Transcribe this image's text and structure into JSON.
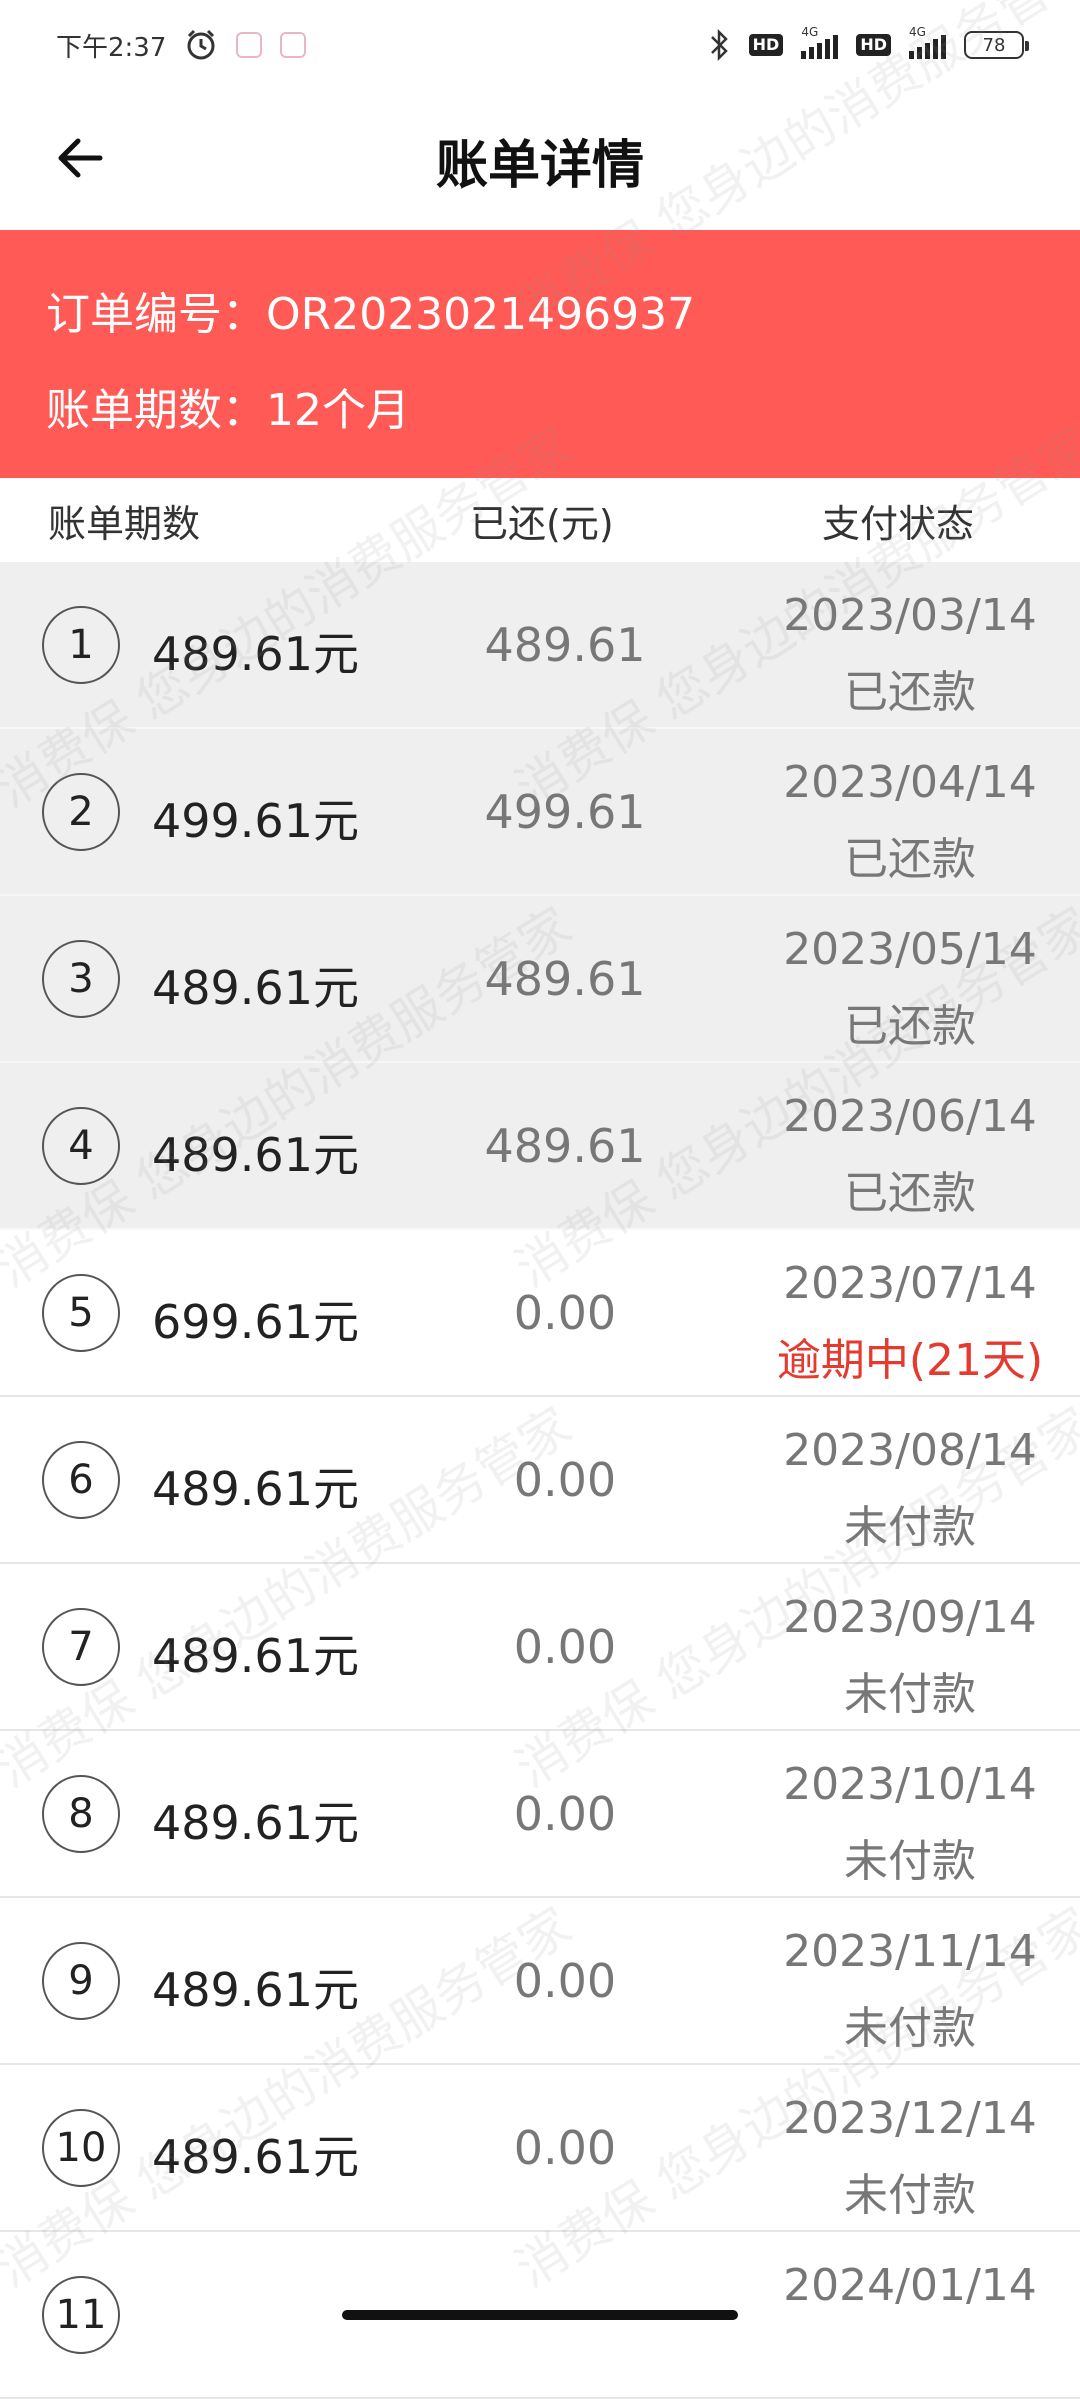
{
  "status_bar": {
    "time": "下午2:37",
    "battery": "78",
    "network_1": "4G",
    "network_2": "4G",
    "hd": "HD"
  },
  "header": {
    "title": "账单详情"
  },
  "banner": {
    "order_line": "订单编号：OR2023021496937",
    "period_line": "账单期数：12个月",
    "background_color": "#ff5a55"
  },
  "columns": {
    "col1": "账单期数",
    "col2": "已还(元)",
    "col3": "支付状态"
  },
  "rows": [
    {
      "num": "1",
      "amount": "489.61元",
      "paid": "489.61",
      "date": "2023/03/14",
      "status": "已还款",
      "state": "paid"
    },
    {
      "num": "2",
      "amount": "499.61元",
      "paid": "499.61",
      "date": "2023/04/14",
      "status": "已还款",
      "state": "paid"
    },
    {
      "num": "3",
      "amount": "489.61元",
      "paid": "489.61",
      "date": "2023/05/14",
      "status": "已还款",
      "state": "paid"
    },
    {
      "num": "4",
      "amount": "489.61元",
      "paid": "489.61",
      "date": "2023/06/14",
      "status": "已还款",
      "state": "paid"
    },
    {
      "num": "5",
      "amount": "699.61元",
      "paid": "0.00",
      "date": "2023/07/14",
      "status": "逾期中(21天)",
      "state": "overdue"
    },
    {
      "num": "6",
      "amount": "489.61元",
      "paid": "0.00",
      "date": "2023/08/14",
      "status": "未付款",
      "state": "unpaid"
    },
    {
      "num": "7",
      "amount": "489.61元",
      "paid": "0.00",
      "date": "2023/09/14",
      "status": "未付款",
      "state": "unpaid"
    },
    {
      "num": "8",
      "amount": "489.61元",
      "paid": "0.00",
      "date": "2023/10/14",
      "status": "未付款",
      "state": "unpaid"
    },
    {
      "num": "9",
      "amount": "489.61元",
      "paid": "0.00",
      "date": "2023/11/14",
      "status": "未付款",
      "state": "unpaid"
    },
    {
      "num": "10",
      "amount": "489.61元",
      "paid": "0.00",
      "date": "2023/12/14",
      "status": "未付款",
      "state": "unpaid"
    },
    {
      "num": "11",
      "amount": "",
      "paid": "",
      "date": "2024/01/14",
      "status": "",
      "state": "unpaid"
    }
  ],
  "watermark_text": "消费保 您身边的消费服务管家",
  "colors": {
    "accent": "#ff5a55",
    "overdue": "#e53a2f",
    "paid_row_bg": "#efefef"
  },
  "icons": {
    "back": "arrow-left-icon",
    "alarm": "alarm-icon",
    "bluetooth": "bluetooth-icon"
  }
}
